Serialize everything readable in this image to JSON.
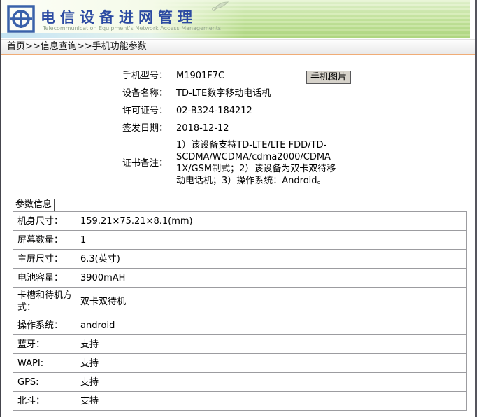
{
  "header": {
    "title": "电信设备进网管理",
    "subtitle": "Telecommunication Equipment's Network Access Managements"
  },
  "breadcrumb": {
    "items": [
      "首页",
      "信息查询",
      "手机功能参数"
    ],
    "separator": ">>"
  },
  "device_info": {
    "fields": [
      {
        "label": "手机型号：",
        "value": "M1901F7C"
      },
      {
        "label": "设备名称：",
        "value": "TD-LTE数字移动电话机"
      },
      {
        "label": "许可证号：",
        "value": "02-B324-184212"
      },
      {
        "label": "签发日期：",
        "value": "2018-12-12"
      },
      {
        "label": "证书备注：",
        "value": "1）该设备支持TD-LTE/LTE FDD/TD-SCDMA/WCDMA/cdma2000/CDMA 1X/GSM制式；2）该设备为双卡双待移动电话机；3）操作系统：Android。"
      }
    ],
    "photo_button_label": "手机图片"
  },
  "parameters": {
    "section_label": "参数信息",
    "rows": [
      {
        "label": "机身尺寸：",
        "value": "159.21×75.21×8.1(mm)"
      },
      {
        "label": "屏幕数量：",
        "value": "1"
      },
      {
        "label": "主屏尺寸：",
        "value": "6.3(英寸)"
      },
      {
        "label": "电池容量：",
        "value": "3900mAH"
      },
      {
        "label": "卡槽和待机方式：",
        "value": "双卡双待机"
      },
      {
        "label": "操作系统：",
        "value": "android"
      },
      {
        "label": "蓝牙：",
        "value": "支持"
      },
      {
        "label": "WAPI:",
        "value": "支持"
      },
      {
        "label": "GPS:",
        "value": "支持"
      },
      {
        "label": "北斗：",
        "value": "支持"
      }
    ]
  },
  "colors": {
    "brand_blue": "#2b4aa2",
    "header_green": "#bade90",
    "breadcrumb_underline": "#f0ac76",
    "button_bg": "#d6d2ca"
  }
}
